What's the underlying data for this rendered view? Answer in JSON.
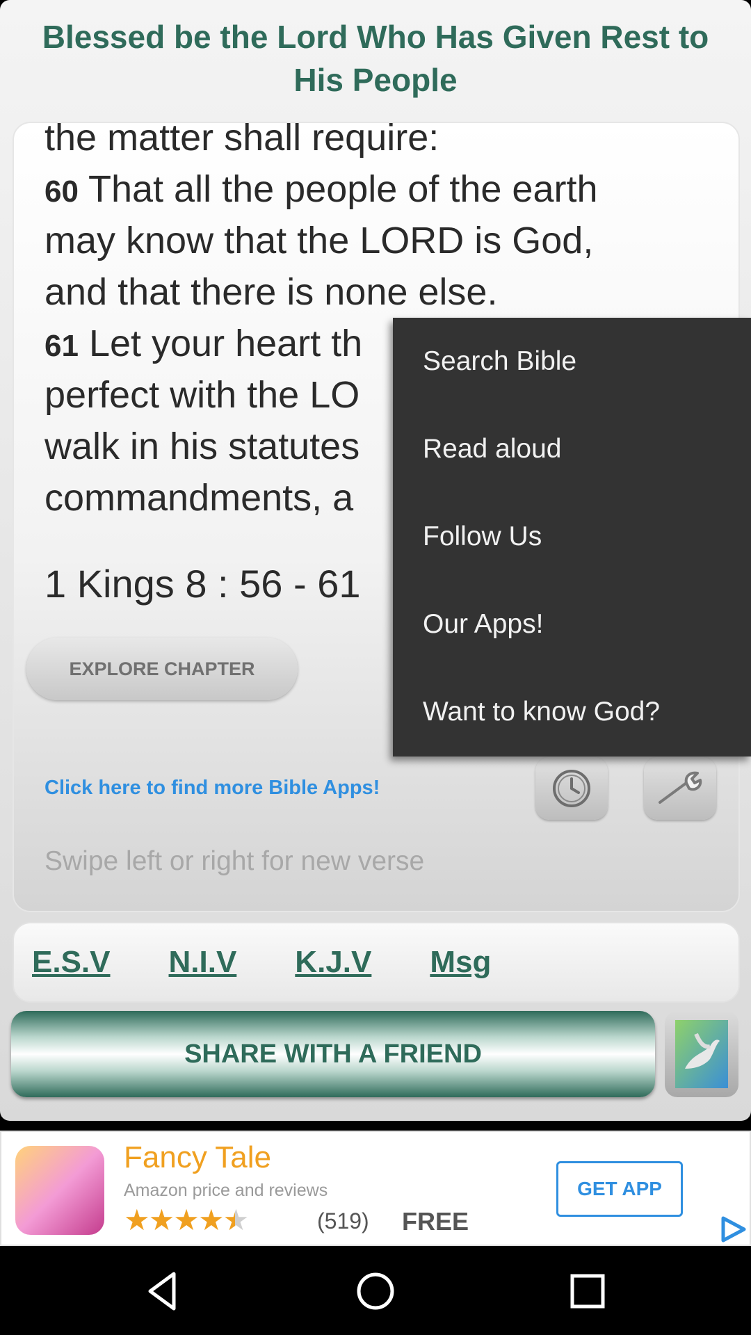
{
  "header": {
    "title": "Blessed be the Lord Who Has Given Rest to His People"
  },
  "verse": {
    "lines": [
      {
        "num": "",
        "text": "the matter shall require:"
      },
      {
        "num": "60",
        "text": " That all the people of the earth"
      },
      {
        "num": "",
        "text": "may know that the LORD is God,"
      },
      {
        "num": "",
        "text": "and that there is none else."
      },
      {
        "num": "61",
        "text": " Let your heart th"
      },
      {
        "num": "",
        "text": "perfect with the LO"
      },
      {
        "num": "",
        "text": "walk in his statutes"
      },
      {
        "num": "",
        "text": "commandments, a"
      }
    ],
    "reference": "1 Kings 8 : 56 - 61"
  },
  "buttons": {
    "explore": "EXPLORE CHAPTER",
    "more_apps": "Click here to find more Bible Apps!",
    "share": "SHARE WITH A FRIEND"
  },
  "hint": "Swipe left or right for new verse",
  "translations": [
    "E.S.V",
    "N.I.V",
    "K.J.V",
    "Msg"
  ],
  "menu": {
    "items": [
      "Search Bible",
      "Read aloud",
      "Follow Us",
      "Our Apps!",
      "Want to know God?"
    ]
  },
  "ad": {
    "title": "Fancy Tale",
    "subtitle": "Amazon price and reviews",
    "rating": 4.5,
    "stars": "★★★★★",
    "count": "(519)",
    "price": "FREE",
    "cta": "GET APP"
  },
  "colors": {
    "accent": "#2f6b5a",
    "link": "#2f8fe0",
    "menu_bg": "#333333",
    "ad_orange": "#f0a020"
  },
  "icons": [
    "clock-icon",
    "wrench-icon",
    "dove-thumbnail-icon",
    "ad-play-icon",
    "back-icon",
    "home-icon",
    "recents-icon"
  ]
}
